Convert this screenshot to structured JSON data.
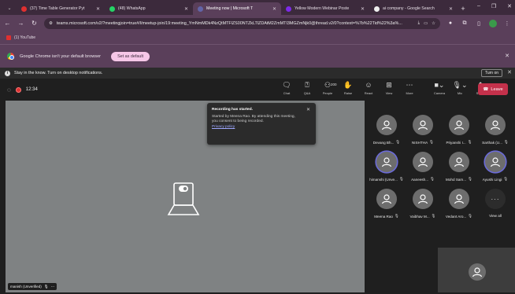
{
  "browser": {
    "tabs": [
      {
        "label": "(37) Time Table Generator Pyt",
        "icon": "youtube-icon",
        "color": "#e03030",
        "active": false
      },
      {
        "label": "(48) WhatsApp",
        "icon": "whatsapp-icon",
        "color": "#25d366",
        "active": false
      },
      {
        "label": "Meeting now | Microsoft T",
        "icon": "teams-icon",
        "color": "#6264a7",
        "active": true
      },
      {
        "label": "Yellow Modern Webinar Poste",
        "icon": "canva-icon",
        "color": "#7d2ae8",
        "active": false
      },
      {
        "label": "ai company - Google Search",
        "icon": "google-icon",
        "color": "#eeeeee",
        "active": false
      }
    ],
    "url": "teams.microsoft.com/v2/?meetingjoin=true#/l/meetup-join/19:meeting_YmNmMDk4NzQtMTFlZS00NTZkLTlZDAtM2ZmMTI3MGZmNjk0@thread.v2/0?context=%7b%22Tid%22%3a%...",
    "bookmark": "(1) YouTube"
  },
  "infobar": {
    "message": "Google Chrome isn't your default browser",
    "button": "Set as default"
  },
  "notification": {
    "message": "Stay in the know. Turn on desktop notifications.",
    "button": "Turn on"
  },
  "meeting": {
    "timer": "12:34",
    "tools": [
      {
        "id": "chat",
        "label": "Chat",
        "icon": "chat-icon"
      },
      {
        "id": "qa",
        "label": "Q&A",
        "icon": "qa-icon"
      },
      {
        "id": "people",
        "label": "People",
        "icon": "people-icon",
        "count": "200"
      },
      {
        "id": "raise",
        "label": "Raise",
        "icon": "raise-hand-icon"
      },
      {
        "id": "react",
        "label": "React",
        "icon": "react-icon"
      },
      {
        "id": "view",
        "label": "View",
        "icon": "view-icon"
      },
      {
        "id": "more",
        "label": "More",
        "icon": "more-icon"
      },
      {
        "id": "camera",
        "label": "Camera",
        "icon": "camera-off-icon"
      },
      {
        "id": "mic",
        "label": "Mic",
        "icon": "mic-off-icon"
      },
      {
        "id": "share",
        "label": "Share",
        "icon": "share-icon"
      }
    ],
    "leave_label": "Leave"
  },
  "recording_popup": {
    "title": "Recording has started.",
    "body": "Started by Meena Rao. By attending this meeting, you consent to being recorded.",
    "link": "Privacy policy"
  },
  "main_tile": {
    "name": "manish (Unverified)"
  },
  "participants": [
    {
      "name": "Devang Bh...",
      "ring": false
    },
    {
      "name": "NISHTHA",
      "ring": false
    },
    {
      "name": "Priyanshi I...",
      "ring": false
    },
    {
      "name": "Sarthak (U...",
      "ring": false
    },
    {
      "name": "himanshi (Unve...",
      "ring": true
    },
    {
      "name": "Aaneesh...",
      "ring": false
    },
    {
      "name": "Mohd Sam...",
      "ring": false
    },
    {
      "name": "Ayushi Lingi",
      "ring": true
    },
    {
      "name": "Meena Rao",
      "ring": false
    },
    {
      "name": "Vaibhav M...",
      "ring": false
    },
    {
      "name": "Vedant Aro...",
      "ring": false
    }
  ],
  "view_all": "View all"
}
